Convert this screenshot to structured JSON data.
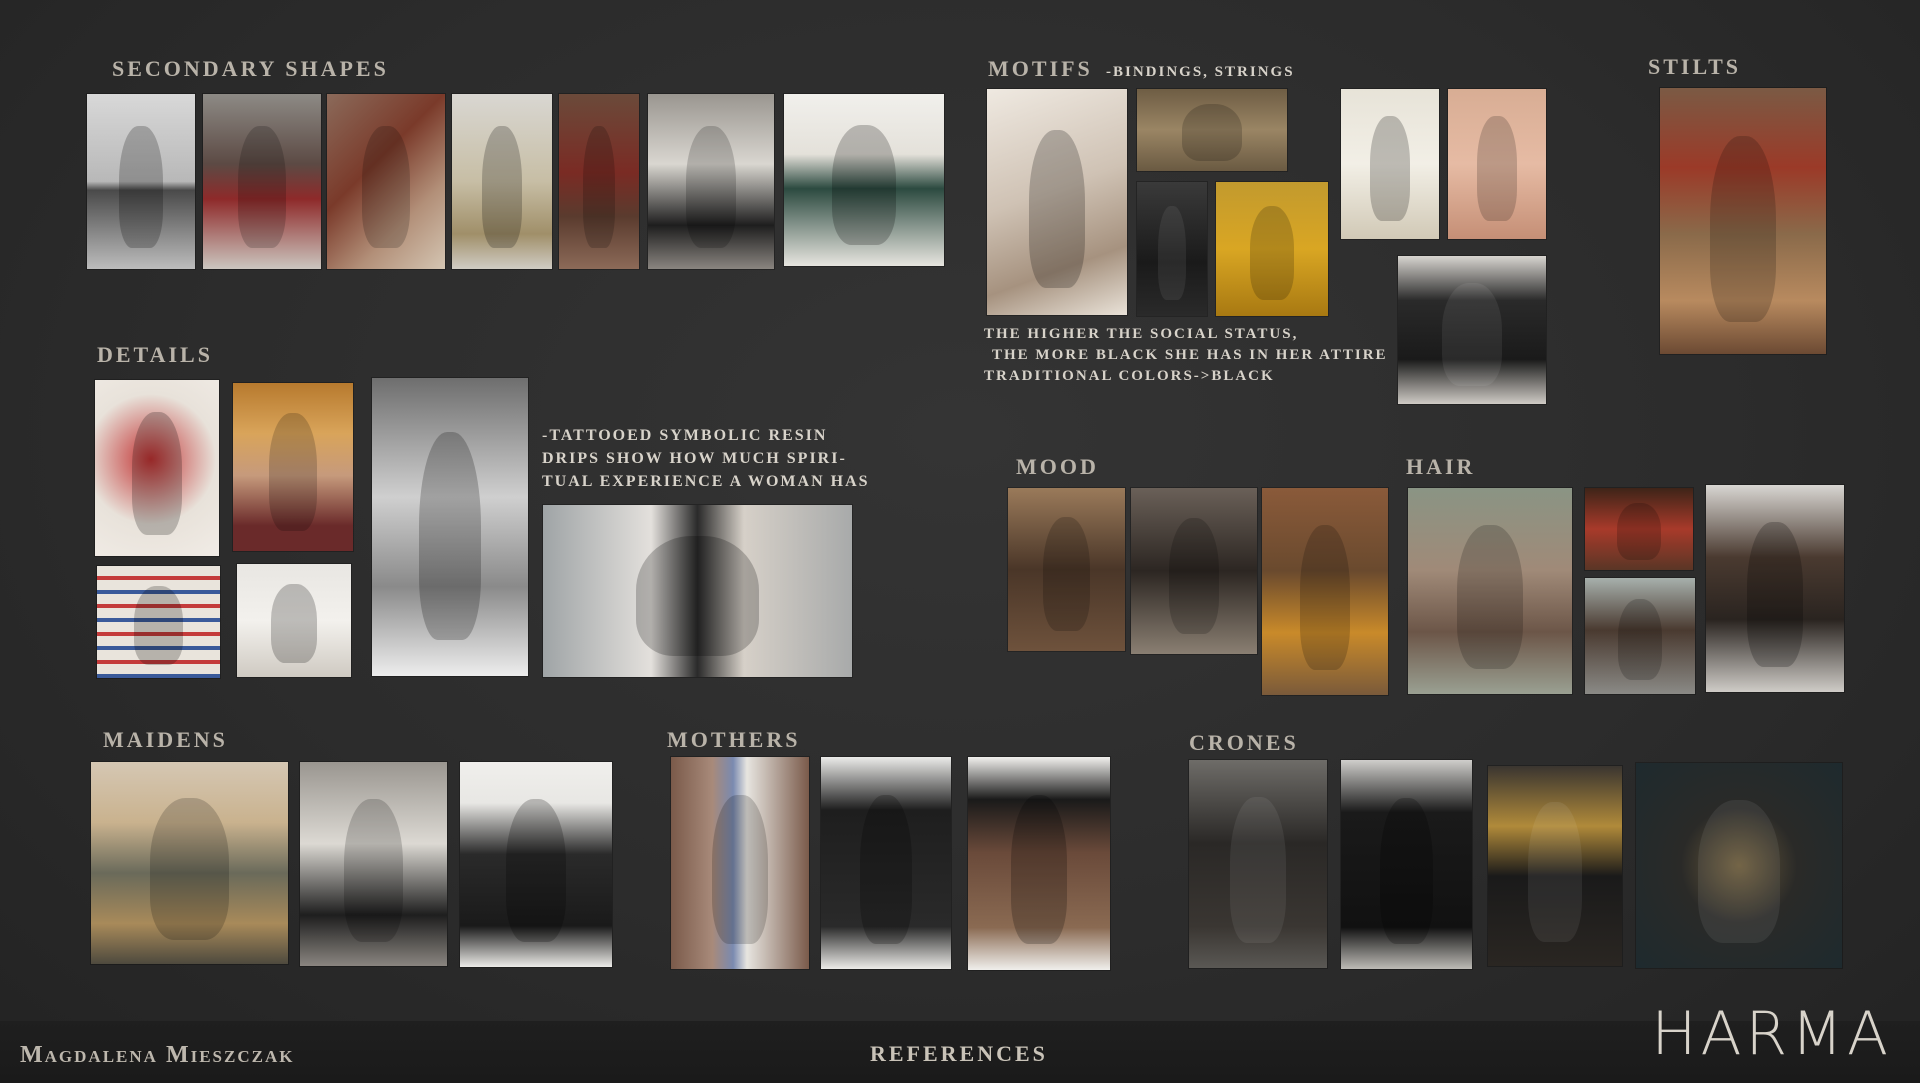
{
  "sections": {
    "secondary_shapes": "SECONDARY SHAPES",
    "motifs": "MOTIFS",
    "motifs_sub": "-BINDINGS, STRINGS",
    "stilts": "STILTS",
    "details": "DETAILS",
    "mood": "MOOD",
    "hair": "HAIR",
    "maidens": "MAIDENS",
    "mothers": "MOTHERS",
    "crones": "CRONES"
  },
  "notes": {
    "motifs_line1": "THE HIGHER THE SOCIAL STATUS,",
    "motifs_line2": "THE MORE BLACK SHE HAS IN HER ATTIRE",
    "motifs_line3": "TRADITIONAL COLORS->BLACK",
    "details_line1": "-TATTOOED SYMBOLIC RESIN",
    "details_line2": "DRIPS SHOW HOW MUCH SPIRI-",
    "details_line3": "TUAL EXPERIENCE A WOMAN HAS"
  },
  "footer": {
    "author": "Magdalena Mieszczak",
    "title": "REFERENCES",
    "logo": "HARMA"
  }
}
